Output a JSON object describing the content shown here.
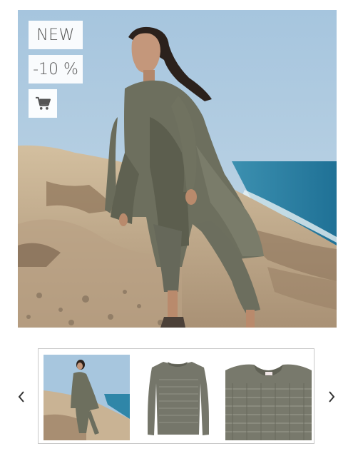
{
  "badges": {
    "new_label": "NEW",
    "discount_label": "-10 %"
  },
  "icons": {
    "cart": "shopping-cart-icon",
    "prev": "chevron-left-icon",
    "next": "chevron-right-icon"
  },
  "colors": {
    "sky": "#8fb6d6",
    "sea": "#2f86a8",
    "sand": "#c9b394",
    "garment_olive": "#6f7160",
    "icon_gray": "#555555"
  },
  "gallery": {
    "thumbnails": [
      {
        "name": "thumb-model-on-dunes"
      },
      {
        "name": "thumb-sweater-front"
      },
      {
        "name": "thumb-sweater-detail"
      }
    ]
  }
}
